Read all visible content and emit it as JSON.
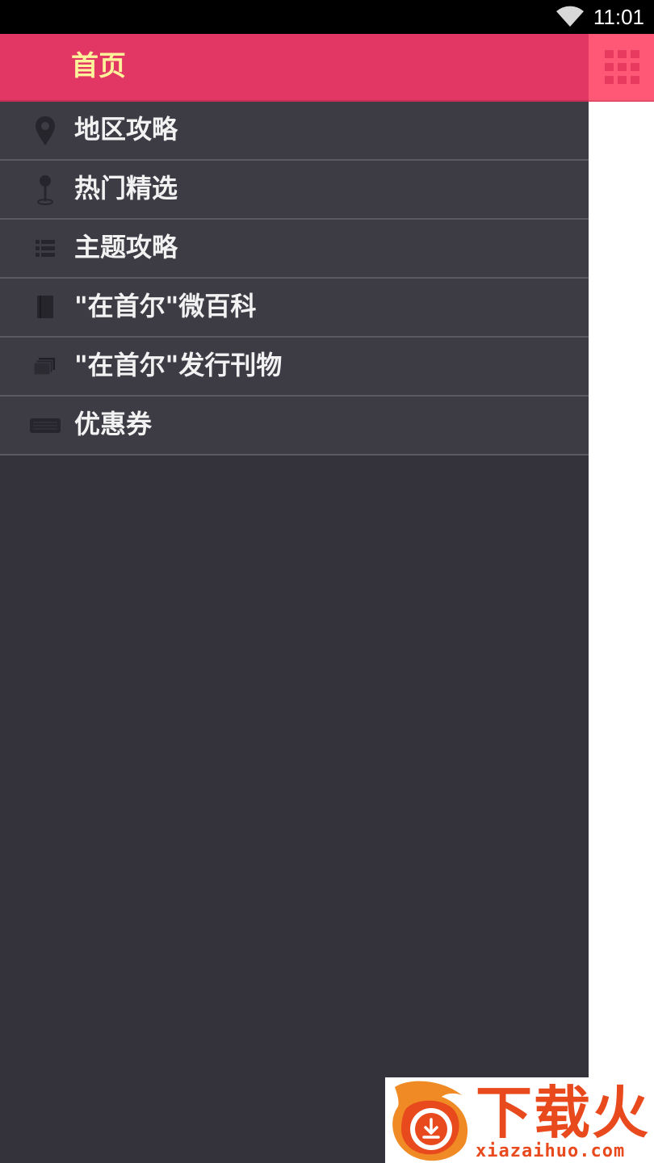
{
  "status_bar": {
    "time": "11:01",
    "wifi_icon": "wifi-icon"
  },
  "drawer": {
    "title": "首页",
    "menu_items": [
      {
        "label": "地区攻略",
        "icon": "map-pin-icon"
      },
      {
        "label": "热门精选",
        "icon": "push-pin-icon"
      },
      {
        "label": "主题攻略",
        "icon": "list-icon"
      },
      {
        "label": "\"在首尔\"微百科",
        "icon": "book-icon"
      },
      {
        "label": "\"在首尔\"发行刊物",
        "icon": "stacked-pages-icon"
      },
      {
        "label": "优惠券",
        "icon": "coupon-icon"
      }
    ]
  },
  "action_bar": {
    "grid_icon": "grid-menu-icon"
  },
  "watermark": {
    "brand": "下载火",
    "domain": "xiazaihuo.com"
  },
  "colors": {
    "header_pink": "#e23764",
    "title_yellow": "#fdf39a",
    "drawer_bg": "#34333c",
    "item_bg": "#3d3c45",
    "strip_pink": "#fe5876",
    "watermark_orange": "#e8491d"
  }
}
